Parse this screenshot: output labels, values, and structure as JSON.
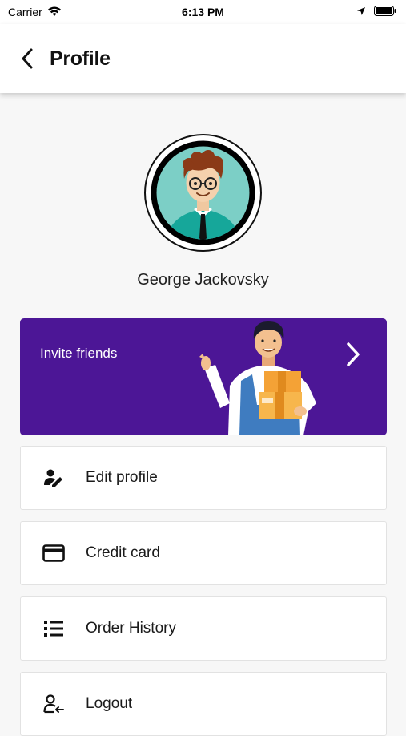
{
  "status_bar": {
    "carrier": "Carrier",
    "time": "6:13 PM"
  },
  "header": {
    "title": "Profile"
  },
  "user": {
    "name": "George Jackovsky"
  },
  "invite": {
    "label": "Invite friends",
    "background_color": "#4c1696"
  },
  "menu": [
    {
      "label": "Edit profile",
      "icon": "edit-user-icon"
    },
    {
      "label": "Credit card",
      "icon": "credit-card-icon"
    },
    {
      "label": "Order History",
      "icon": "list-icon"
    },
    {
      "label": "Logout",
      "icon": "logout-user-icon"
    }
  ]
}
